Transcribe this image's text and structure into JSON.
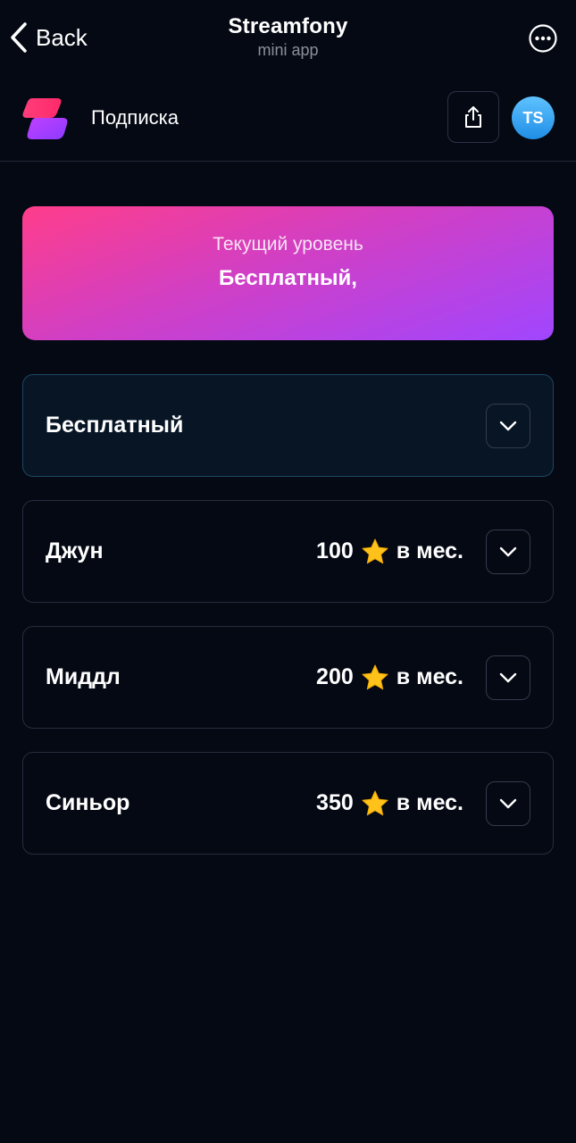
{
  "topbar": {
    "back_label": "Back",
    "title": "Streamfony",
    "subtitle": "mini app"
  },
  "header": {
    "page_title": "Подписка",
    "avatar_initials": "TS"
  },
  "current_level": {
    "label": "Текущий уровень",
    "value": "Бесплатный,"
  },
  "tiers": [
    {
      "name": "Бесплатный",
      "price": "",
      "period": "",
      "selected": true
    },
    {
      "name": "Джун",
      "price": "100",
      "period": "в мес.",
      "selected": false
    },
    {
      "name": "Миддл",
      "price": "200",
      "period": "в мес.",
      "selected": false
    },
    {
      "name": "Синьор",
      "price": "350",
      "period": "в мес.",
      "selected": false
    }
  ],
  "icons": {
    "back": "chevron-left-icon",
    "more": "more-dots-icon",
    "share": "share-icon",
    "star": "star-icon",
    "expand": "chevron-down-icon"
  },
  "colors": {
    "background": "#050914",
    "accent_gradient_start": "#ff3d8b",
    "accent_gradient_end": "#a046ff",
    "avatar": "#3aa7f5",
    "star": "#ffc21a"
  }
}
